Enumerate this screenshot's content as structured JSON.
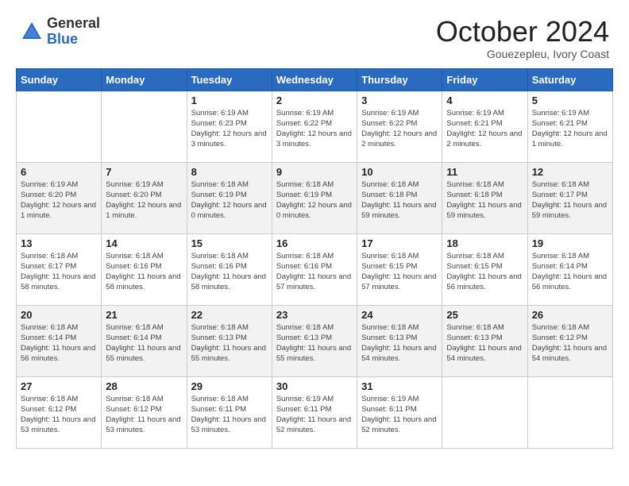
{
  "header": {
    "logo_general": "General",
    "logo_blue": "Blue",
    "month_title": "October 2024",
    "subtitle": "Gouezepleu, Ivory Coast"
  },
  "days_of_week": [
    "Sunday",
    "Monday",
    "Tuesday",
    "Wednesday",
    "Thursday",
    "Friday",
    "Saturday"
  ],
  "weeks": [
    [
      {
        "day": "",
        "info": ""
      },
      {
        "day": "",
        "info": ""
      },
      {
        "day": "1",
        "info": "Sunrise: 6:19 AM\nSunset: 6:23 PM\nDaylight: 12 hours and 3 minutes."
      },
      {
        "day": "2",
        "info": "Sunrise: 6:19 AM\nSunset: 6:22 PM\nDaylight: 12 hours and 3 minutes."
      },
      {
        "day": "3",
        "info": "Sunrise: 6:19 AM\nSunset: 6:22 PM\nDaylight: 12 hours and 2 minutes."
      },
      {
        "day": "4",
        "info": "Sunrise: 6:19 AM\nSunset: 6:21 PM\nDaylight: 12 hours and 2 minutes."
      },
      {
        "day": "5",
        "info": "Sunrise: 6:19 AM\nSunset: 6:21 PM\nDaylight: 12 hours and 1 minute."
      }
    ],
    [
      {
        "day": "6",
        "info": "Sunrise: 6:19 AM\nSunset: 6:20 PM\nDaylight: 12 hours and 1 minute."
      },
      {
        "day": "7",
        "info": "Sunrise: 6:19 AM\nSunset: 6:20 PM\nDaylight: 12 hours and 1 minute."
      },
      {
        "day": "8",
        "info": "Sunrise: 6:18 AM\nSunset: 6:19 PM\nDaylight: 12 hours and 0 minutes."
      },
      {
        "day": "9",
        "info": "Sunrise: 6:18 AM\nSunset: 6:19 PM\nDaylight: 12 hours and 0 minutes."
      },
      {
        "day": "10",
        "info": "Sunrise: 6:18 AM\nSunset: 6:18 PM\nDaylight: 11 hours and 59 minutes."
      },
      {
        "day": "11",
        "info": "Sunrise: 6:18 AM\nSunset: 6:18 PM\nDaylight: 11 hours and 59 minutes."
      },
      {
        "day": "12",
        "info": "Sunrise: 6:18 AM\nSunset: 6:17 PM\nDaylight: 11 hours and 59 minutes."
      }
    ],
    [
      {
        "day": "13",
        "info": "Sunrise: 6:18 AM\nSunset: 6:17 PM\nDaylight: 11 hours and 58 minutes."
      },
      {
        "day": "14",
        "info": "Sunrise: 6:18 AM\nSunset: 6:16 PM\nDaylight: 11 hours and 58 minutes."
      },
      {
        "day": "15",
        "info": "Sunrise: 6:18 AM\nSunset: 6:16 PM\nDaylight: 11 hours and 58 minutes."
      },
      {
        "day": "16",
        "info": "Sunrise: 6:18 AM\nSunset: 6:16 PM\nDaylight: 11 hours and 57 minutes."
      },
      {
        "day": "17",
        "info": "Sunrise: 6:18 AM\nSunset: 6:15 PM\nDaylight: 11 hours and 57 minutes."
      },
      {
        "day": "18",
        "info": "Sunrise: 6:18 AM\nSunset: 6:15 PM\nDaylight: 11 hours and 56 minutes."
      },
      {
        "day": "19",
        "info": "Sunrise: 6:18 AM\nSunset: 6:14 PM\nDaylight: 11 hours and 56 minutes."
      }
    ],
    [
      {
        "day": "20",
        "info": "Sunrise: 6:18 AM\nSunset: 6:14 PM\nDaylight: 11 hours and 56 minutes."
      },
      {
        "day": "21",
        "info": "Sunrise: 6:18 AM\nSunset: 6:14 PM\nDaylight: 11 hours and 55 minutes."
      },
      {
        "day": "22",
        "info": "Sunrise: 6:18 AM\nSunset: 6:13 PM\nDaylight: 11 hours and 55 minutes."
      },
      {
        "day": "23",
        "info": "Sunrise: 6:18 AM\nSunset: 6:13 PM\nDaylight: 11 hours and 55 minutes."
      },
      {
        "day": "24",
        "info": "Sunrise: 6:18 AM\nSunset: 6:13 PM\nDaylight: 11 hours and 54 minutes."
      },
      {
        "day": "25",
        "info": "Sunrise: 6:18 AM\nSunset: 6:13 PM\nDaylight: 11 hours and 54 minutes."
      },
      {
        "day": "26",
        "info": "Sunrise: 6:18 AM\nSunset: 6:12 PM\nDaylight: 11 hours and 54 minutes."
      }
    ],
    [
      {
        "day": "27",
        "info": "Sunrise: 6:18 AM\nSunset: 6:12 PM\nDaylight: 11 hours and 53 minutes."
      },
      {
        "day": "28",
        "info": "Sunrise: 6:18 AM\nSunset: 6:12 PM\nDaylight: 11 hours and 53 minutes."
      },
      {
        "day": "29",
        "info": "Sunrise: 6:18 AM\nSunset: 6:11 PM\nDaylight: 11 hours and 53 minutes."
      },
      {
        "day": "30",
        "info": "Sunrise: 6:19 AM\nSunset: 6:11 PM\nDaylight: 11 hours and 52 minutes."
      },
      {
        "day": "31",
        "info": "Sunrise: 6:19 AM\nSunset: 6:11 PM\nDaylight: 11 hours and 52 minutes."
      },
      {
        "day": "",
        "info": ""
      },
      {
        "day": "",
        "info": ""
      }
    ]
  ]
}
